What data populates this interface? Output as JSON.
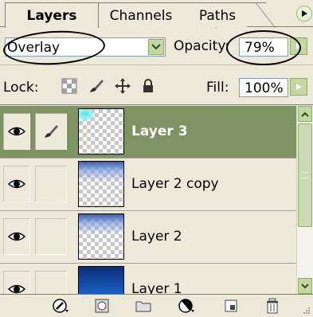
{
  "tabs": [
    {
      "label": "Layers",
      "active": true
    },
    {
      "label": "Channels",
      "active": false
    },
    {
      "label": "Paths",
      "active": false
    }
  ],
  "panel_menu_icon": "play-arrow-icon",
  "blend_mode": {
    "value": "Overlay",
    "dropdown_icon": "chevron-down-icon"
  },
  "opacity": {
    "label": "Opacity:",
    "value": "79%",
    "slider_icon": "play-arrow-icon"
  },
  "lock": {
    "label": "Lock:",
    "icons": [
      "lock-transparency-icon",
      "brush-icon",
      "move-icon",
      "padlock-icon"
    ]
  },
  "fill": {
    "label": "Fill:",
    "value": "100%",
    "slider_icon": "play-arrow-icon"
  },
  "layers": [
    {
      "name": "Layer 3",
      "selected": true,
      "visible": true,
      "brush_linked": true,
      "thumb": "transparent-with-cyan-corner"
    },
    {
      "name": "Layer 2 copy",
      "selected": false,
      "visible": true,
      "brush_linked": false,
      "thumb": "transparent-with-blue-top"
    },
    {
      "name": "Layer 2",
      "selected": false,
      "visible": true,
      "brush_linked": false,
      "thumb": "transparent-with-blue-top"
    },
    {
      "name": "Layer 1",
      "selected": false,
      "visible": true,
      "brush_linked": false,
      "thumb": "solid-blue-gradient"
    }
  ],
  "toolbar": {
    "icons": [
      "layer-style-icon",
      "layer-mask-icon",
      "folder-icon",
      "adjustment-layer-icon",
      "new-layer-icon",
      "trash-icon"
    ]
  },
  "colors": {
    "panel_bg": "#ece9d8",
    "selected_row": "#7e9264",
    "accent_green": "#c1d8a0"
  }
}
